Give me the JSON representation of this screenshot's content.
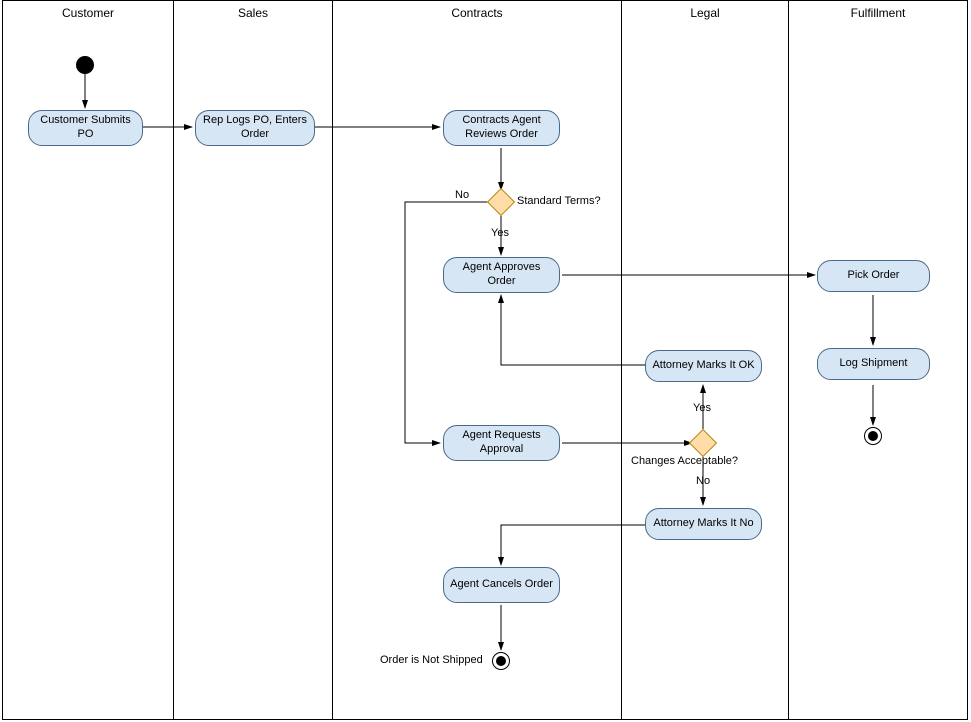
{
  "lanes": {
    "customer": "Customer",
    "sales": "Sales",
    "contracts": "Contracts",
    "legal": "Legal",
    "fulfillment": "Fulfillment"
  },
  "nodes": {
    "submit_po": "Customer Submits PO",
    "rep_logs": "Rep Logs PO, Enters Order",
    "reviews": "Contracts Agent Reviews Order",
    "approves": "Agent Approves Order",
    "requests": "Agent Requests Approval",
    "cancels": "Agent Cancels Order",
    "marks_ok": "Attorney Marks It OK",
    "marks_no": "Attorney Marks It No",
    "pick": "Pick Order",
    "log_ship": "Log Shipment"
  },
  "decisions": {
    "std_terms": "Standard Terms?",
    "changes_ok": "Changes Acceptable?"
  },
  "edge_labels": {
    "yes1": "Yes",
    "no1": "No",
    "yes2": "Yes",
    "no2": "No",
    "not_shipped": "Order is Not Shipped"
  }
}
